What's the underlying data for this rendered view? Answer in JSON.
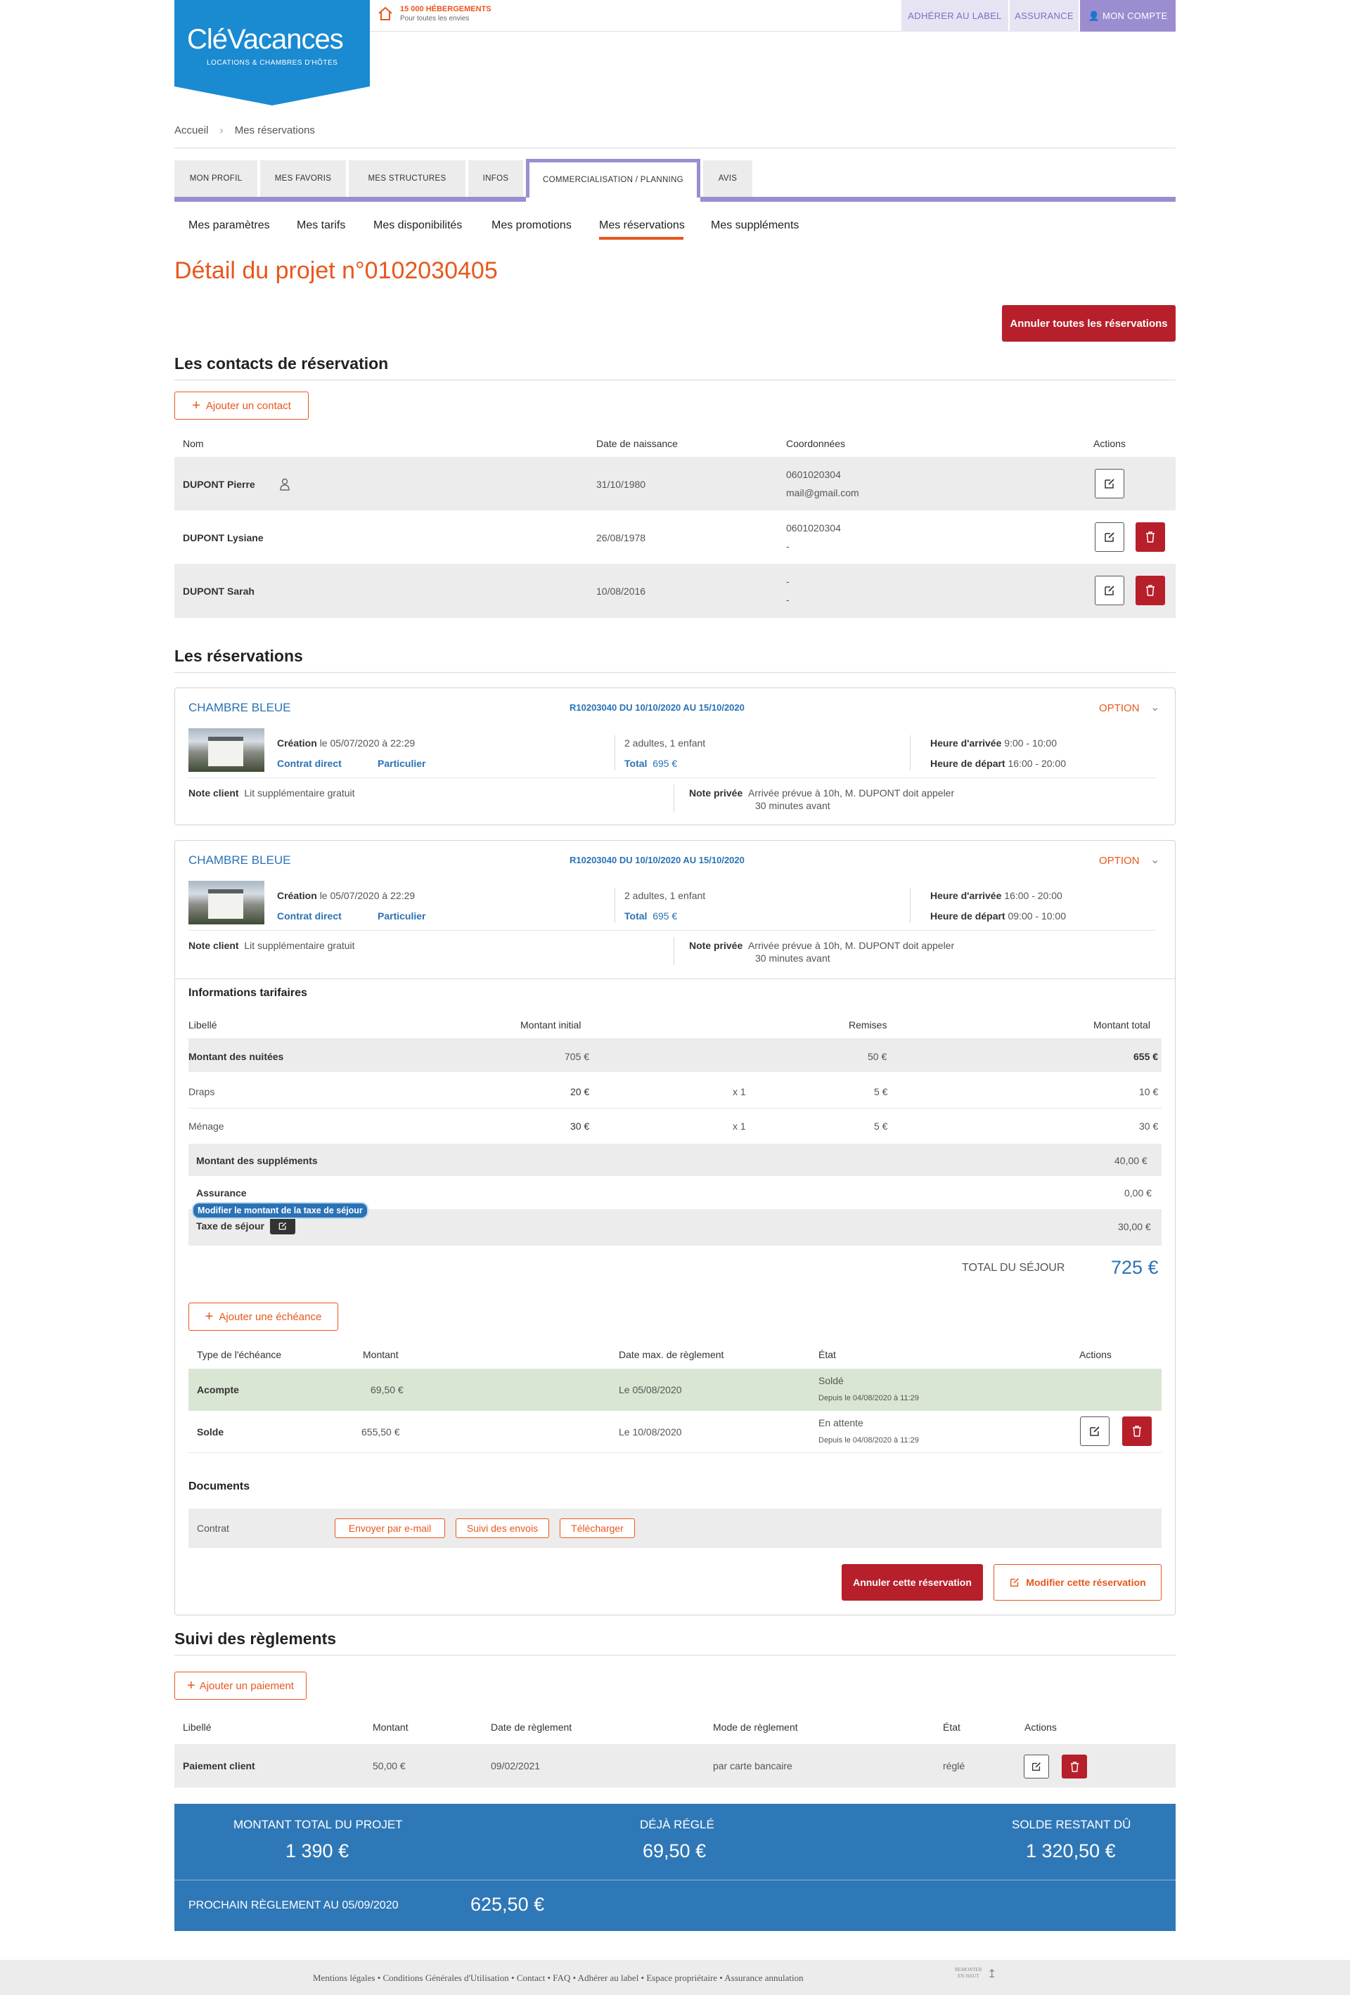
{
  "header": {
    "logo_text": "CléVacances",
    "logo_sub": "LOCATIONS & CHAMBRES D'HÔTES",
    "promo_line1": "15 000 HÉBERGEMENTS",
    "promo_line2": "Pour toutes les envies",
    "btn_join": "ADHÉRER AU LABEL",
    "btn_insurance": "ASSURANCE",
    "btn_account": "MON COMPTE"
  },
  "breadcrumb": {
    "home": "Accueil",
    "current": "Mes réservations"
  },
  "tabs": [
    "MON PROFIL",
    "MES FAVORIS",
    "MES STRUCTURES",
    "INFOS",
    "COMMERCIALISATION / PLANNING",
    "AVIS"
  ],
  "subnav": [
    "Mes paramètres",
    "Mes tarifs",
    "Mes disponibilités",
    "Mes promotions",
    "Mes réservations",
    "Mes suppléments"
  ],
  "page_title": "Détail du projet n°0102030405",
  "cancel_all": "Annuler toutes les réservations",
  "contacts": {
    "title": "Les contacts de réservation",
    "add": "Ajouter un contact",
    "headers": [
      "Nom",
      "Date de naissance",
      "Coordonnées",
      "Actions"
    ],
    "rows": [
      {
        "name": "DUPONT Pierre",
        "dob": "31/10/1980",
        "c1": "0601020304",
        "c2": "mail@gmail.com"
      },
      {
        "name": "DUPONT Lysiane",
        "dob": "26/08/1978",
        "c1": "0601020304",
        "c2": "-"
      },
      {
        "name": "DUPONT Sarah",
        "dob": "10/08/2016",
        "c1": "-",
        "c2": "-"
      }
    ]
  },
  "reservations": {
    "title": "Les réservations",
    "cards": [
      {
        "room": "CHAMBRE BLEUE",
        "ref": "R10203040 DU 10/10/2020 AU 15/10/2020",
        "status": "OPTION",
        "creation_label": "Création",
        "creation": "le 05/07/2020 à 22:29",
        "channel": "Contrat direct",
        "client_type": "Particulier",
        "guests": "2 adultes, 1 enfant",
        "total_label": "Total",
        "total": "695 €",
        "arrival_label": "Heure d'arrivée",
        "arrival": "9:00 - 10:00",
        "departure_label": "Heure de départ",
        "departure": "16:00 - 20:00",
        "note_client_label": "Note client",
        "note_client": "Lit supplémentaire gratuit",
        "note_private_label": "Note privée",
        "note_private_1": "Arrivée prévue à 10h, M. DUPONT doit appeler",
        "note_private_2": "30 minutes avant"
      },
      {
        "room": "CHAMBRE BLEUE",
        "ref": "R10203040 DU 10/10/2020 AU 15/10/2020",
        "status": "OPTION",
        "creation_label": "Création",
        "creation": "le 05/07/2020 à 22:29",
        "channel": "Contrat direct",
        "client_type": "Particulier",
        "guests": "2 adultes, 1 enfant",
        "total_label": "Total",
        "total": "695 €",
        "arrival_label": "Heure d'arrivée",
        "arrival": "16:00 - 20:00",
        "departure_label": "Heure de départ",
        "departure": "09:00 - 10:00",
        "note_client_label": "Note client",
        "note_client": "Lit supplémentaire gratuit",
        "note_private_label": "Note privée",
        "note_private_1": "Arrivée prévue à 10h, M. DUPONT doit appeler",
        "note_private_2": "30 minutes avant"
      }
    ]
  },
  "tarif": {
    "title": "Informations tarifaires",
    "headers": [
      "Libellé",
      "Montant initial",
      "Remises",
      "Montant total"
    ],
    "nights": {
      "label": "Montant des nuitées",
      "initial": "705 €",
      "discount": "50 €",
      "total": "655 €"
    },
    "items": [
      {
        "label": "Draps",
        "initial": "20 €",
        "qty": "x 1",
        "discount": "5 €",
        "total": "10 €"
      },
      {
        "label": "Ménage",
        "initial": "30 €",
        "qty": "x 1",
        "discount": "5 €",
        "total": "30 €"
      }
    ],
    "supp": {
      "label": "Montant des suppléments",
      "total": "40,00 €"
    },
    "insurance": {
      "label": "Assurance",
      "total": "0,00 €"
    },
    "tax": {
      "label": "Taxe de séjour",
      "total": "30,00 €",
      "tooltip": "Modifier le montant de la taxe de séjour"
    },
    "grand_label": "TOTAL DU SÉJOUR",
    "grand_total": "725 €"
  },
  "echeances": {
    "add": "Ajouter une échéance",
    "headers": [
      "Type de l'échéance",
      "Montant",
      "Date max. de règlement",
      "État",
      "Actions"
    ],
    "rows": [
      {
        "type": "Acompte",
        "amount": "69,50 €",
        "date": "Le 05/08/2020",
        "state": "Soldé",
        "since": "Depuis le 04/08/2020 à 11:29"
      },
      {
        "type": "Solde",
        "amount": "655,50 €",
        "date": "Le 10/08/2020",
        "state": "En attente",
        "since": "Depuis le 04/08/2020 à 11:29"
      }
    ]
  },
  "documents": {
    "title": "Documents",
    "contract": "Contrat",
    "send": "Envoyer par e-mail",
    "track": "Suivi des envois",
    "download": "Télécharger"
  },
  "res_actions": {
    "cancel": "Annuler cette réservation",
    "modify": "Modifier cette réservation"
  },
  "payments": {
    "title": "Suivi des règlements",
    "add": "Ajouter un paiement",
    "headers": [
      "Libellé",
      "Montant",
      "Date de règlement",
      "Mode de règlement",
      "État",
      "Actions"
    ],
    "row": {
      "label": "Paiement client",
      "amount": "50,00 €",
      "date": "09/02/2021",
      "mode": "par carte bancaire",
      "state": "réglé"
    }
  },
  "summary": {
    "total_label": "MONTANT TOTAL DU PROJET",
    "total": "1 390 €",
    "paid_label": "DÉJÀ RÉGLÉ",
    "paid": "69,50 €",
    "due_label": "SOLDE RESTANT DÛ",
    "due": "1 320,50 €",
    "next_label": "PROCHAIN RÈGLEMENT AU 05/09/2020",
    "next": "625,50 €"
  },
  "footer": {
    "links": "Mentions légales • Conditions Générales d'Utilisation • Contact • FAQ • Adhérer au label • Espace propriétaire • Assurance annulation",
    "top1": "REMONTER",
    "top2": "EN HAUT"
  },
  "colors": {
    "orange": "#e8571c",
    "blue": "#2a72b5",
    "red": "#b71f2b",
    "purple": "#9b8dd0",
    "logo": "#1a8ad1",
    "summary": "#2f78b7",
    "paid_row": "#d9e6d3"
  }
}
